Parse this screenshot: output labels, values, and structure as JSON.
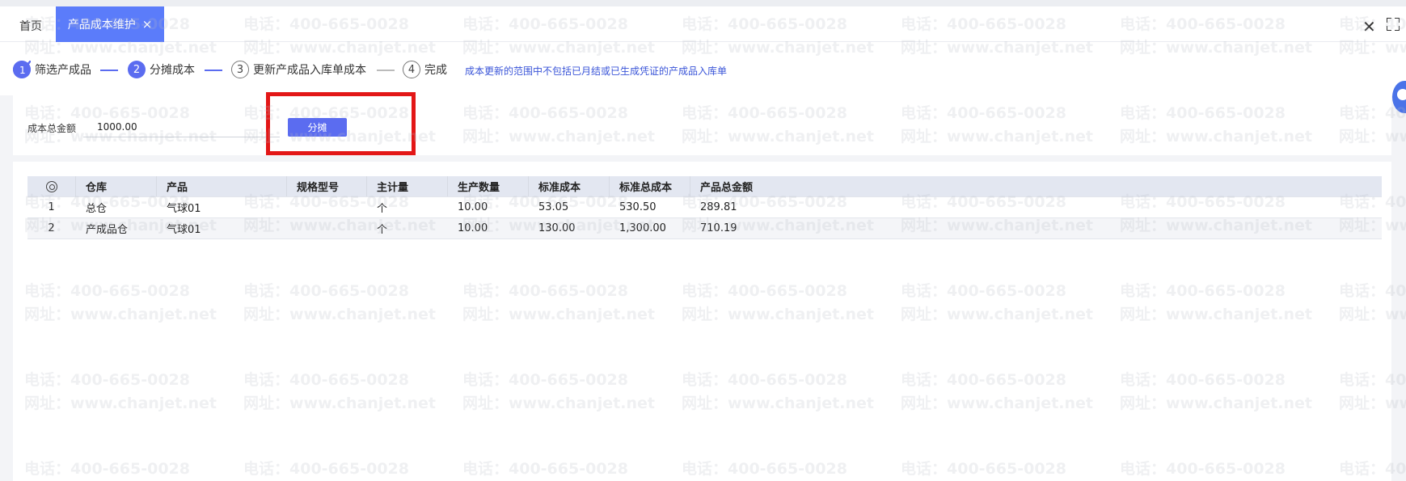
{
  "tabs": {
    "home_label": "首页",
    "active_label": "产品成本维护",
    "close_glyph": "×"
  },
  "window": {
    "close_glyph": "✕"
  },
  "steps": [
    {
      "index": "1",
      "label": "筛选产成品",
      "status": "done"
    },
    {
      "index": "2",
      "label": "分摊成本",
      "status": "active"
    },
    {
      "index": "3",
      "label": "更新产成品入库单成本",
      "status": "todo"
    },
    {
      "index": "4",
      "label": "完成",
      "status": "todo"
    }
  ],
  "step_hint": "成本更新的范围中不包括已月结或已生成凭证的产成品入库单",
  "amount": {
    "label": "成本总金额",
    "value": "1000.00"
  },
  "allocate_button": "分摊",
  "table": {
    "columns": [
      "",
      "仓库",
      "产品",
      "规格型号",
      "主计量",
      "生产数量",
      "标准成本",
      "标准总成本",
      "产品总金额"
    ],
    "rows": [
      [
        "1",
        "总仓",
        "气球01",
        "",
        "个",
        "10.00",
        "53.05",
        "530.50",
        "289.81"
      ],
      [
        "2",
        "产成品仓",
        "气球01",
        "",
        "个",
        "10.00",
        "130.00",
        "1,300.00",
        "710.19"
      ]
    ]
  },
  "watermark": {
    "phone": "电话：400-665-0028",
    "site": "网址：www.chanjet.net"
  },
  "colors": {
    "accent": "#5b6cf0",
    "tab_active": "#5b7cfa",
    "highlight": "#e31717",
    "hint_text": "#3a55d8"
  }
}
